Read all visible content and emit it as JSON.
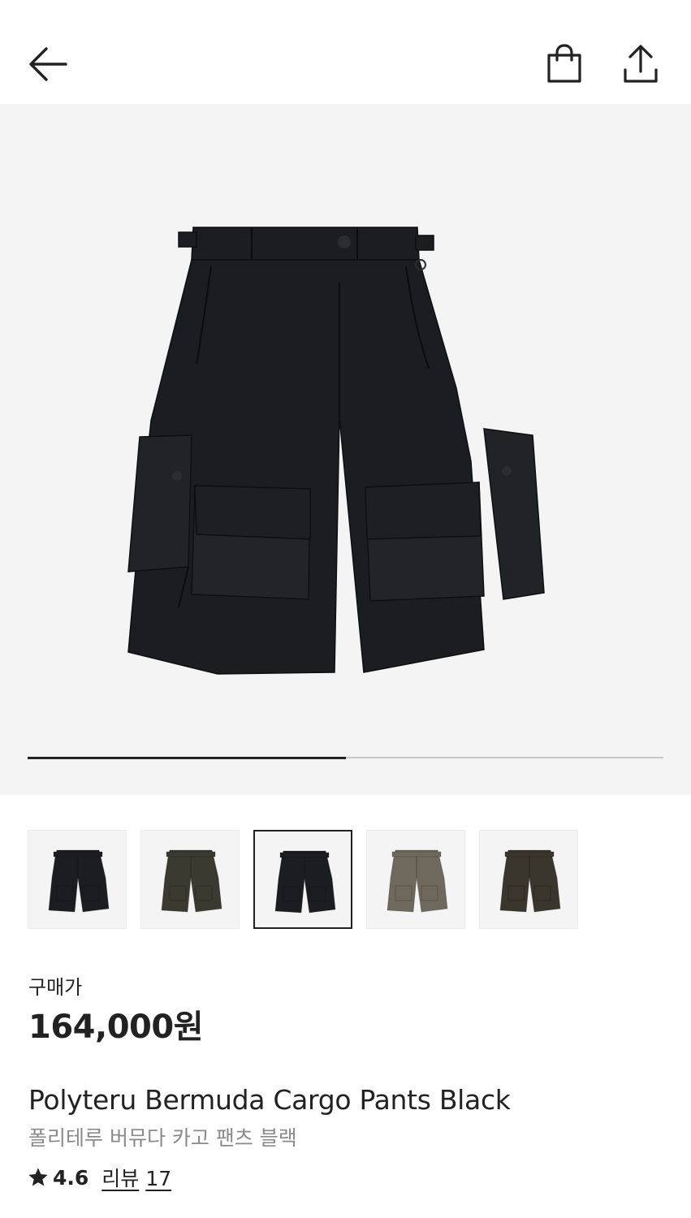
{
  "header": {
    "back_icon": "arrow-left-icon",
    "cart_icon": "shopping-bag-icon",
    "share_icon": "share-upload-icon"
  },
  "gallery": {
    "progress_fraction": 0.5,
    "thumbnails": [
      {
        "color_name": "black",
        "swatch": "#1c1d21"
      },
      {
        "color_name": "dark olive",
        "swatch": "#3a3a30"
      },
      {
        "color_name": "black",
        "swatch": "#1c1d21",
        "selected": true
      },
      {
        "color_name": "khaki",
        "swatch": "#6e695c"
      },
      {
        "color_name": "brown",
        "swatch": "#3b362d"
      }
    ]
  },
  "product": {
    "price_label": "구매가",
    "price": "164,000원",
    "name_en": "Polyteru Bermuda Cargo Pants Black",
    "name_ko": "폴리테루 버뮤다 카고 팬츠 블랙",
    "rating": "4.6",
    "review_label": "리뷰",
    "review_count": "17"
  },
  "colors": {
    "text": "#222222",
    "subtext": "#8a8a8a",
    "hero_bg": "#f4f4f4",
    "product": "#1c1d21"
  }
}
